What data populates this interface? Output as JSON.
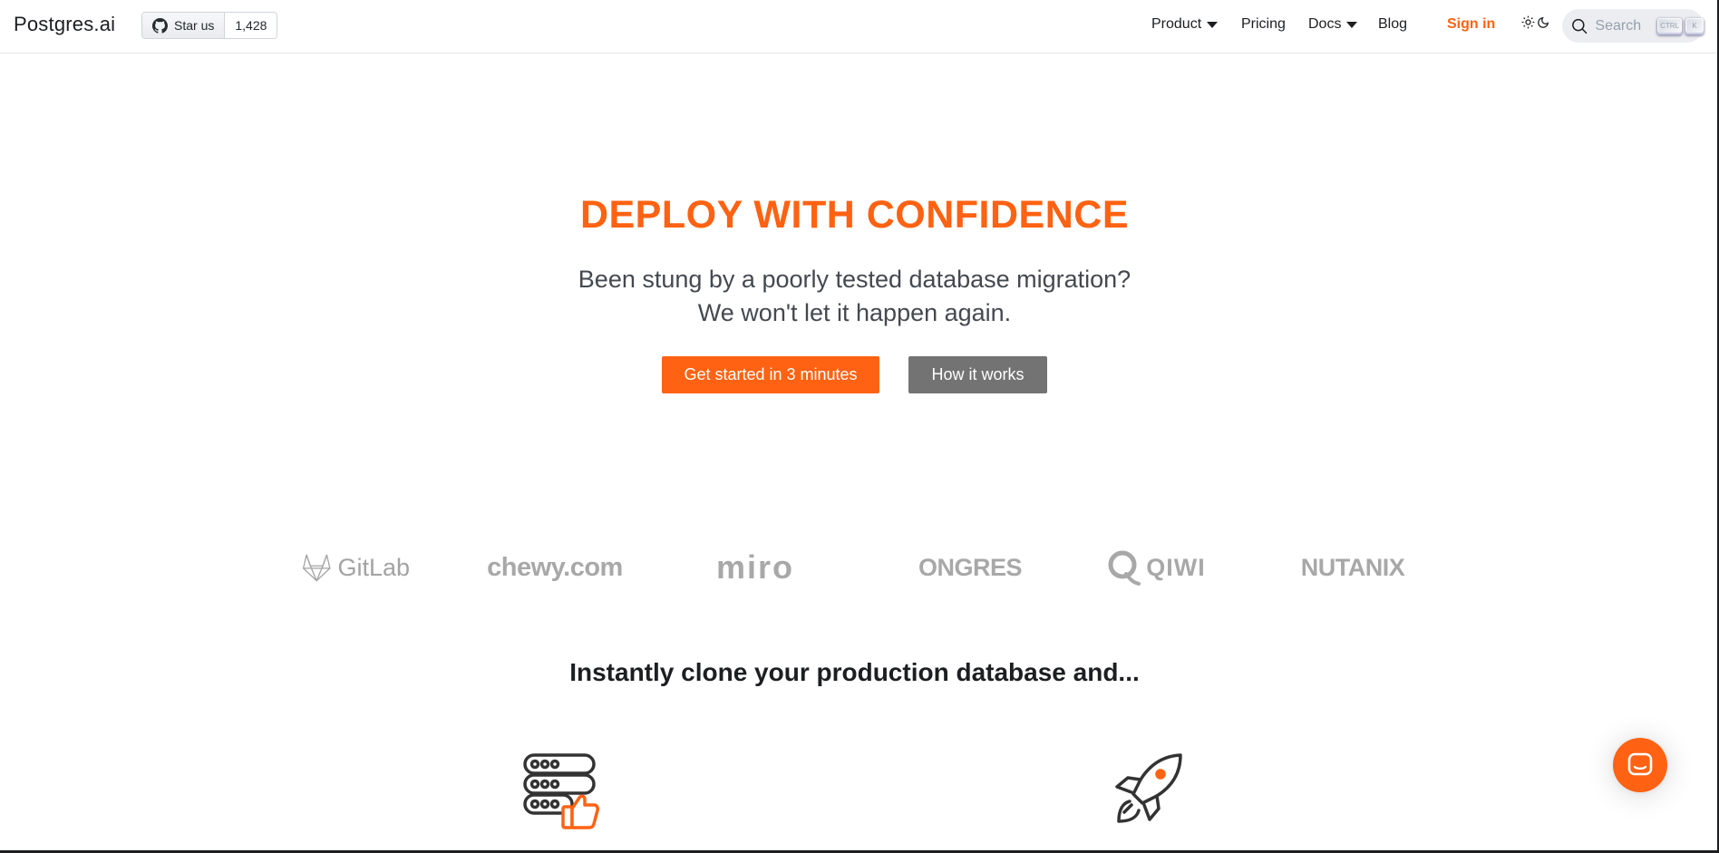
{
  "navbar": {
    "brand": "Postgres.ai",
    "github": {
      "star_label": "Star us",
      "count": "1,428"
    },
    "links": {
      "product": "Product",
      "pricing": "Pricing",
      "docs": "Docs",
      "blog": "Blog",
      "signin": "Sign in"
    },
    "search": {
      "placeholder": "Search",
      "kbd_ctrl": "CTRL",
      "kbd_k": "K"
    }
  },
  "hero": {
    "title": "DEPLOY WITH CONFIDENCE",
    "subtitle_line1": "Been stung by a poorly tested database migration?",
    "subtitle_line2": "We won't let it happen again.",
    "primary_button": "Get started in 3 minutes",
    "secondary_button": "How it works"
  },
  "logos": {
    "gitlab": "GitLab",
    "chewy": "chewy.com",
    "miro": "miro",
    "ongres": "ONGRES",
    "qiwi": "QIWI",
    "nutanix": "NUTANIX"
  },
  "features": {
    "title": "Instantly clone your production database and...",
    "icons": [
      "database-thumbs-up-icon",
      "rocket-icon"
    ]
  },
  "colors": {
    "accent": "#ff6212",
    "secondary_button": "#737373",
    "logo_gray": "#a8a8a8"
  }
}
